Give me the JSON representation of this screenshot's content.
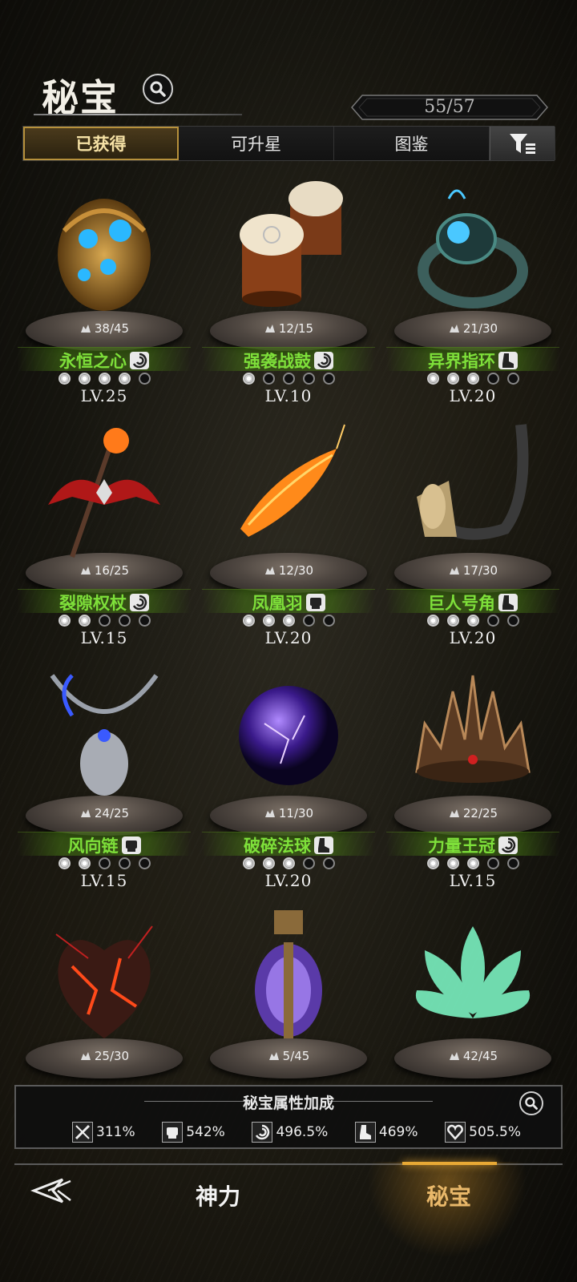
{
  "header": {
    "title": "秘宝",
    "counter": "55/57"
  },
  "tabs": [
    {
      "label": "已获得",
      "active": true
    },
    {
      "label": "可升星",
      "active": false
    },
    {
      "label": "图鉴",
      "active": false
    }
  ],
  "items": [
    {
      "progress": "38/45",
      "name": "永恒之心",
      "type_icon": "swirl-icon",
      "stars_filled": 4,
      "stars_total": 5,
      "level": "LV.25",
      "art": "heart-orb"
    },
    {
      "progress": "12/15",
      "name": "强袭战鼓",
      "type_icon": "swirl-icon",
      "stars_filled": 1,
      "stars_total": 5,
      "level": "LV.10",
      "art": "war-drums"
    },
    {
      "progress": "21/30",
      "name": "异界指环",
      "type_icon": "boot-icon",
      "stars_filled": 3,
      "stars_total": 5,
      "level": "LV.20",
      "art": "ring"
    },
    {
      "progress": "16/25",
      "name": "裂隙权杖",
      "type_icon": "swirl-icon",
      "stars_filled": 2,
      "stars_total": 5,
      "level": "LV.15",
      "art": "scepter"
    },
    {
      "progress": "12/30",
      "name": "凤凰羽",
      "type_icon": "fist-icon",
      "stars_filled": 3,
      "stars_total": 5,
      "level": "LV.20",
      "art": "phoenix-feather"
    },
    {
      "progress": "17/30",
      "name": "巨人号角",
      "type_icon": "boot-icon",
      "stars_filled": 3,
      "stars_total": 5,
      "level": "LV.20",
      "art": "horn"
    },
    {
      "progress": "24/25",
      "name": "风向链",
      "type_icon": "fist-icon",
      "stars_filled": 2,
      "stars_total": 5,
      "level": "LV.15",
      "art": "necklace"
    },
    {
      "progress": "11/30",
      "name": "破碎法球",
      "type_icon": "boot-icon",
      "stars_filled": 3,
      "stars_total": 5,
      "level": "LV.20",
      "art": "orb"
    },
    {
      "progress": "22/25",
      "name": "力量王冠",
      "type_icon": "swirl-icon",
      "stars_filled": 3,
      "stars_total": 5,
      "level": "LV.15",
      "art": "crown"
    },
    {
      "progress": "25/30",
      "art": "lava-heart"
    },
    {
      "progress": "5/45",
      "art": "lantern"
    },
    {
      "progress": "42/45",
      "art": "lotus"
    }
  ],
  "bonus": {
    "title": "秘宝属性加成",
    "stats": [
      {
        "icon": "sword-icon",
        "value": "311%"
      },
      {
        "icon": "fist-icon",
        "value": "542%"
      },
      {
        "icon": "swirl-icon",
        "value": "496.5%"
      },
      {
        "icon": "boot-icon",
        "value": "469%"
      },
      {
        "icon": "heart-icon",
        "value": "505.5%"
      }
    ]
  },
  "nav": {
    "left_label": "神力",
    "right_label": "秘宝",
    "active": "秘宝"
  }
}
